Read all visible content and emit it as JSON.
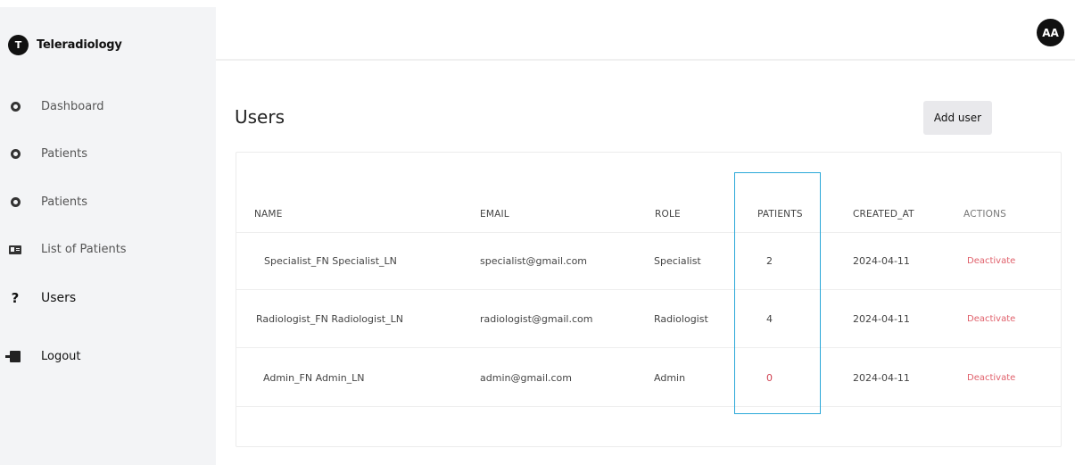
{
  "sidebar": {
    "brand": {
      "initial": "T",
      "name": "Teleradiology"
    },
    "items": [
      {
        "label": "Dashboard",
        "icon": "dot-icon"
      },
      {
        "label": "Patients",
        "icon": "dot-icon"
      },
      {
        "label": "Patients",
        "icon": "dot-icon"
      },
      {
        "label": "List of Patients",
        "icon": "id-card-icon"
      },
      {
        "label": "Users",
        "icon": "question-icon"
      },
      {
        "label": "Logout",
        "icon": "logout-icon"
      }
    ]
  },
  "header": {
    "avatar_initials": "AA"
  },
  "main": {
    "title": "Users",
    "add_user_label": "Add user"
  },
  "table": {
    "columns": [
      "NAME",
      "EMAIL",
      "ROLE",
      "PATIENTS",
      "CREATED_AT",
      "ACTIONS"
    ],
    "rows": [
      {
        "name": "Specialist_FN Specialist_LN",
        "email": "specialist@gmail.com",
        "role": "Specialist",
        "patients": "2",
        "created_at": "2024-04-11",
        "action": "Deactivate"
      },
      {
        "name": "Radiologist_FN Radiologist_LN",
        "email": "radiologist@gmail.com",
        "role": "Radiologist",
        "patients": "4",
        "created_at": "2024-04-11",
        "action": "Deactivate"
      },
      {
        "name": "Admin_FN Admin_LN",
        "email": "admin@gmail.com",
        "role": "Admin",
        "patients": "0",
        "created_at": "2024-04-11",
        "action": "Deactivate"
      }
    ]
  },
  "colors": {
    "sidebar_bg": "#f3f4f6",
    "deactivate": "#e0606b",
    "highlight": "#2aa8d8"
  }
}
